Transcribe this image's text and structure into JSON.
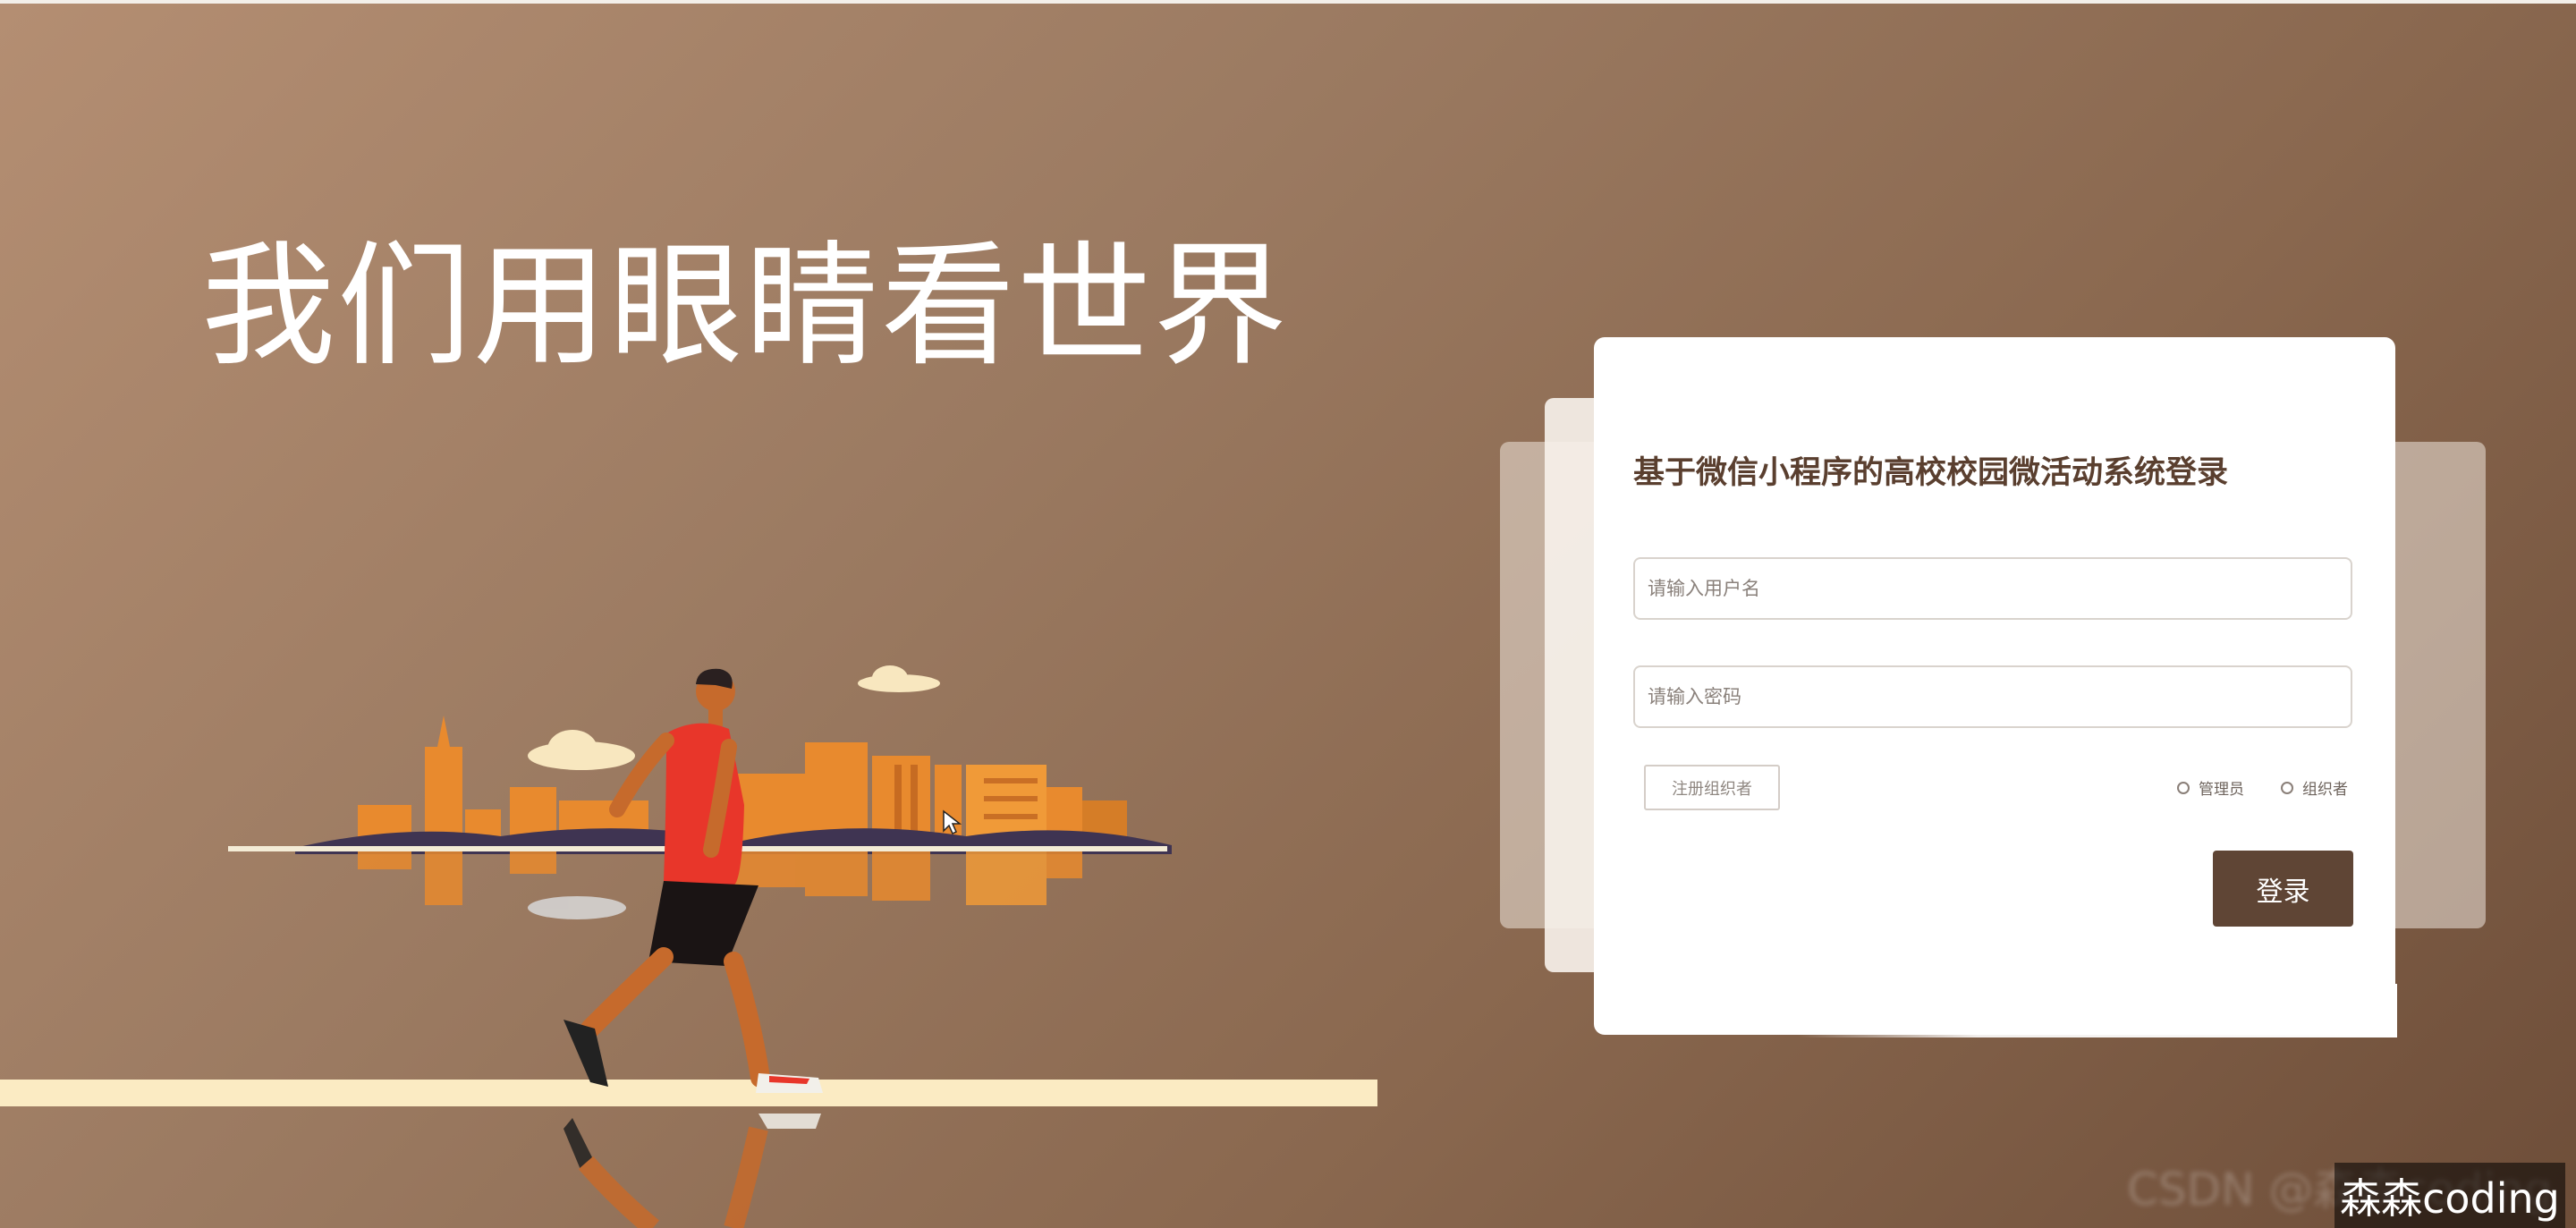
{
  "hero": {
    "slogan": "我们用眼睛看世界"
  },
  "login": {
    "title": "基于微信小程序的高校校园微活动系统登录",
    "username_placeholder": "请输入用户名",
    "password_placeholder": "请输入密码",
    "register_label": "注册组织者",
    "roles": [
      {
        "label": "管理员"
      },
      {
        "label": "组织者"
      }
    ],
    "submit_label": "登录"
  },
  "watermark": {
    "blurred": "CSDN @森森coding",
    "label": "森森coding"
  },
  "colors": {
    "primary_button": "#5f4535",
    "title": "#5a3f2f",
    "background_start": "#b48e72",
    "background_end": "#6e4e39"
  },
  "icons": [
    "radio-icon",
    "mouse-cursor-icon"
  ]
}
